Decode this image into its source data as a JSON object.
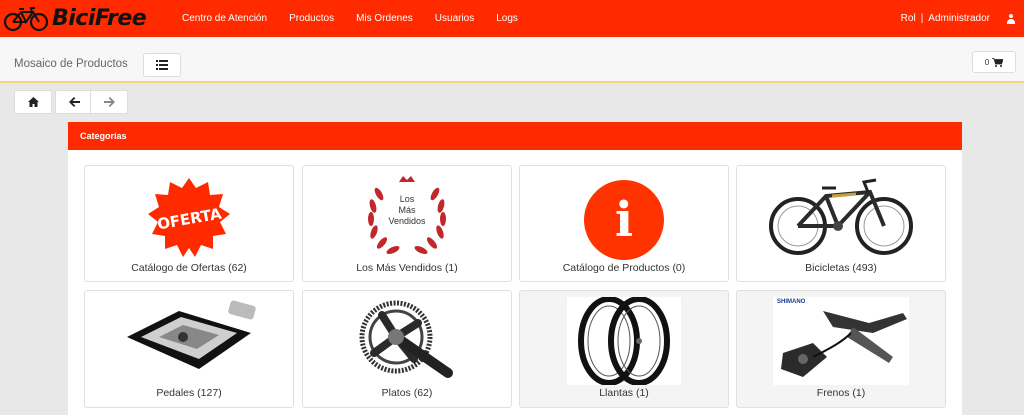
{
  "brand": {
    "name": "BiciFree"
  },
  "nav": {
    "items": [
      {
        "label": "Centro de Atención"
      },
      {
        "label": "Productos"
      },
      {
        "label": "Mis Ordenes"
      },
      {
        "label": "Usuarios"
      },
      {
        "label": "Logs"
      }
    ],
    "rol_label": "Rol",
    "separator": "|",
    "role_value": "Administrador"
  },
  "subheader": {
    "title": "Mosaico de Productos",
    "cart_count": "0"
  },
  "panel": {
    "title": "Categorías"
  },
  "categories": [
    {
      "label": "Catálogo de Ofertas (62)",
      "badge_text": "OFERTA"
    },
    {
      "label": "Los Más Vendidos (1)",
      "badge_lines": [
        "Los",
        "Más",
        "Vendidos"
      ]
    },
    {
      "label": "Catálogo de Productos (0)",
      "badge_text": "i"
    },
    {
      "label": "Bicicletas (493)"
    },
    {
      "label": "Pedales  (127)"
    },
    {
      "label": "Platos   (62)"
    },
    {
      "label": "Llantas    (1)"
    },
    {
      "label": "Frenos  (1)",
      "brand_text": "SHIMANO"
    }
  ],
  "colors": {
    "primary": "#ff2a00",
    "accent_border": "#f3d77a",
    "laurel": "#c0282c"
  }
}
